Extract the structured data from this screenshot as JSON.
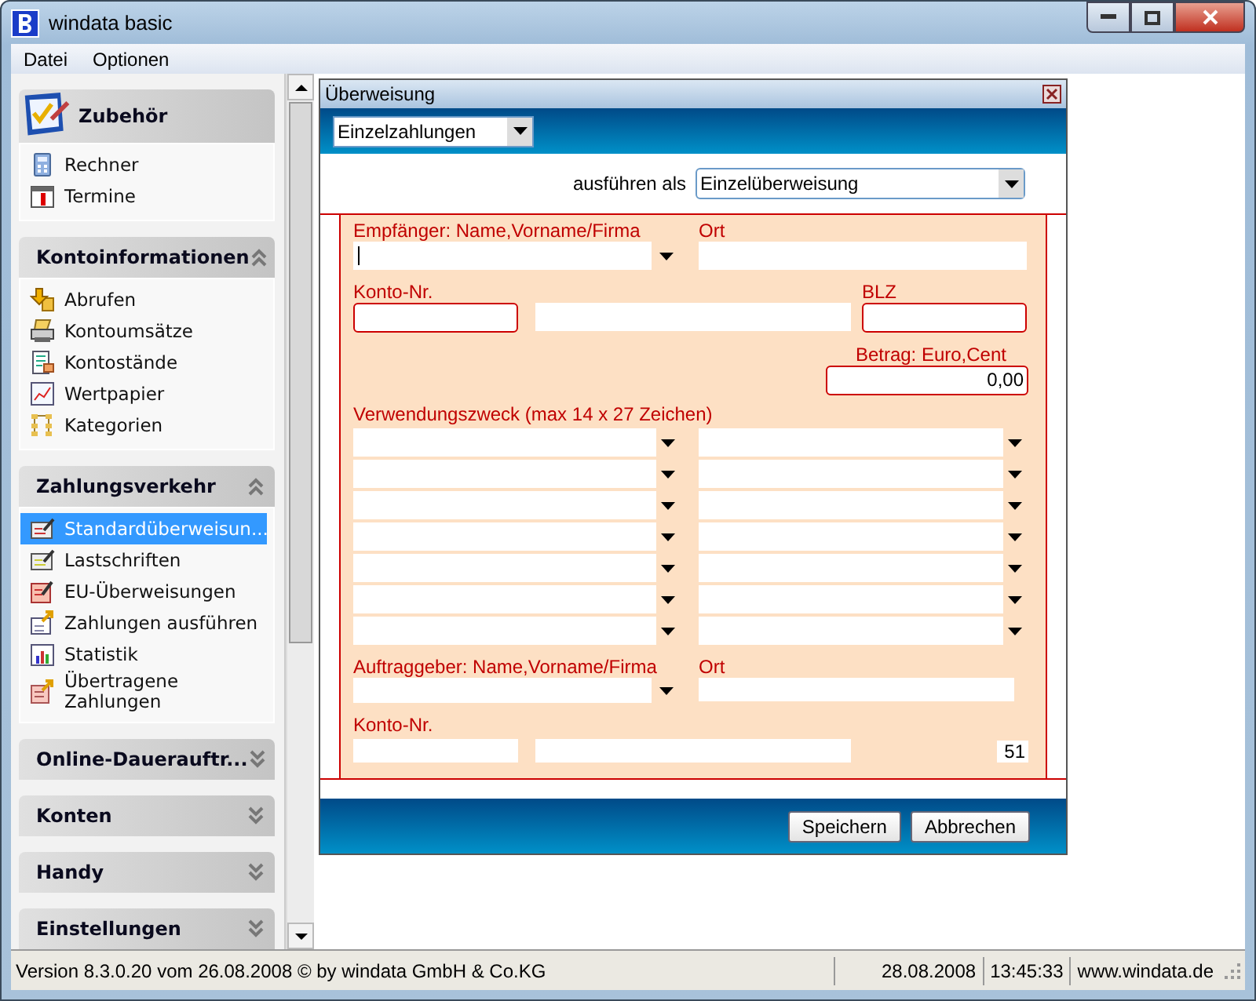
{
  "window": {
    "title": "windata basic"
  },
  "menu": [
    "Datei",
    "Optionen"
  ],
  "sidebar": {
    "groups": [
      {
        "title": "Zubehör",
        "kind": "featured",
        "expanded": true,
        "items": [
          {
            "label": "Rechner",
            "selected": false
          },
          {
            "label": "Termine",
            "selected": false
          }
        ]
      },
      {
        "title": "Kontoinformationen",
        "kind": "normal",
        "expanded": true,
        "items": [
          {
            "label": "Abrufen",
            "selected": false
          },
          {
            "label": "Kontoumsätze",
            "selected": false
          },
          {
            "label": "Kontostände",
            "selected": false
          },
          {
            "label": "Wertpapier",
            "selected": false
          },
          {
            "label": "Kategorien",
            "selected": false
          }
        ]
      },
      {
        "title": "Zahlungsverkehr",
        "kind": "normal",
        "expanded": true,
        "items": [
          {
            "label": "Standardüberweisun...",
            "selected": true
          },
          {
            "label": "Lastschriften",
            "selected": false
          },
          {
            "label": "EU-Überweisungen",
            "selected": false
          },
          {
            "label": "Zahlungen ausführen",
            "selected": false
          },
          {
            "label": "Statistik",
            "selected": false
          },
          {
            "label": "Übertragene Zahlungen",
            "selected": false
          }
        ]
      },
      {
        "title": "Online-Dauerauftr...",
        "kind": "normal",
        "expanded": false
      },
      {
        "title": "Konten",
        "kind": "normal",
        "expanded": false
      },
      {
        "title": "Handy",
        "kind": "normal",
        "expanded": false
      },
      {
        "title": "Einstellungen",
        "kind": "normal",
        "expanded": false
      }
    ]
  },
  "dialog": {
    "title": "Überweisung",
    "mode_select": "Einzelzahlungen",
    "execute_as": {
      "label": "ausführen als",
      "value": "Einzelüberweisung"
    },
    "recipient": {
      "name_label": "Empfänger: Name,Vorname/Firma",
      "place_label": "Ort",
      "account_label": "Konto-Nr.",
      "bank_code_label": "BLZ",
      "amount_label": "Betrag: Euro,Cent",
      "amount_value": "0,00"
    },
    "purpose": {
      "label": "Verwendungszweck (max 14 x 27 Zeichen)"
    },
    "payer": {
      "name_label": "Auftraggeber: Name,Vorname/Firma",
      "place_label": "Ort",
      "account_label": "Konto-Nr.",
      "counter": "51"
    },
    "buttons": [
      "Speichern",
      "Abbrechen"
    ]
  },
  "status_bar": {
    "version": "Version 8.3.0.20 vom 26.08.2008 © by windata GmbH & Co.KG",
    "date": "28.08.2008",
    "time": "13:45:33",
    "website": "www.windata.de"
  }
}
